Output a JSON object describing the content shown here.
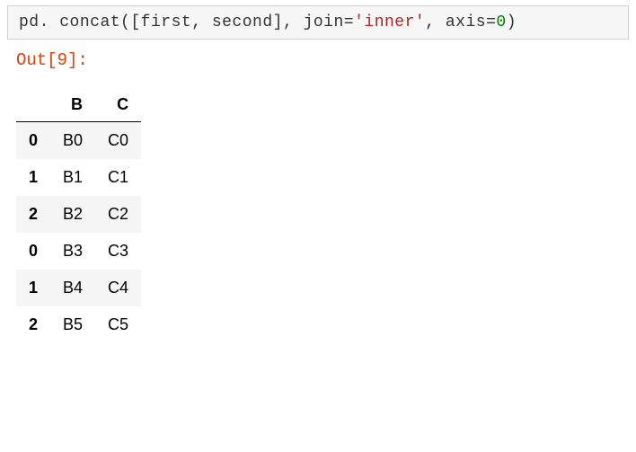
{
  "code": {
    "pd": "pd",
    "dot": ".",
    "concat": "concat",
    "lparen": "(",
    "lbracket": "[",
    "first": "first",
    "comma1": ",",
    "second": "second",
    "rbracket": "]",
    "comma2": ",",
    "join_kw": "join",
    "eq1": "=",
    "join_val": "'inner'",
    "comma3": ",",
    "axis_kw": "axis",
    "eq2": "=",
    "axis_val": "0",
    "rparen": ")"
  },
  "out_label": "Out[9]:",
  "chart_data": {
    "type": "table",
    "columns": [
      "B",
      "C"
    ],
    "index": [
      "0",
      "1",
      "2",
      "0",
      "1",
      "2"
    ],
    "rows": [
      [
        "B0",
        "C0"
      ],
      [
        "B1",
        "C1"
      ],
      [
        "B2",
        "C2"
      ],
      [
        "B3",
        "C3"
      ],
      [
        "B4",
        "C4"
      ],
      [
        "B5",
        "C5"
      ]
    ]
  },
  "table": {
    "head": {
      "c0": "B",
      "c1": "C"
    },
    "r0": {
      "idx": "0",
      "c0": "B0",
      "c1": "C0"
    },
    "r1": {
      "idx": "1",
      "c0": "B1",
      "c1": "C1"
    },
    "r2": {
      "idx": "2",
      "c0": "B2",
      "c1": "C2"
    },
    "r3": {
      "idx": "0",
      "c0": "B3",
      "c1": "C3"
    },
    "r4": {
      "idx": "1",
      "c0": "B4",
      "c1": "C4"
    },
    "r5": {
      "idx": "2",
      "c0": "B5",
      "c1": "C5"
    }
  }
}
